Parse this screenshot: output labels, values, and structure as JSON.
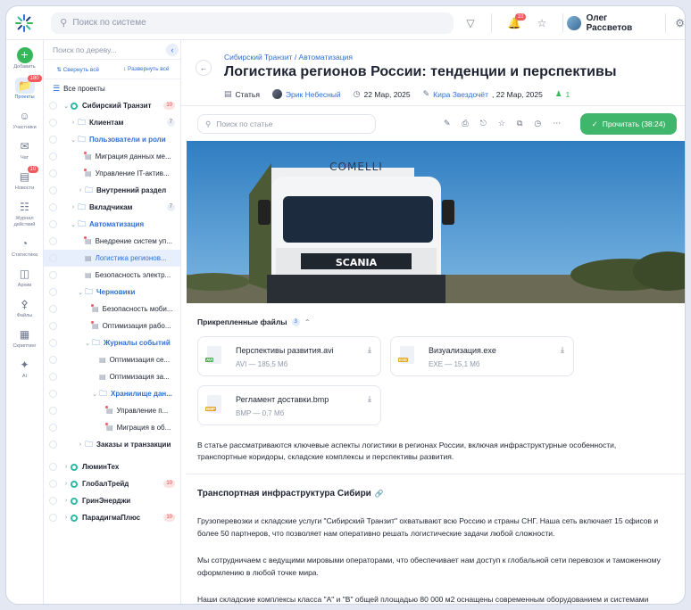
{
  "topbar": {
    "search_placeholder": "Поиск по системе",
    "notifications_badge": "10",
    "user_name": "Олег Рассветов"
  },
  "rail": [
    {
      "label": "Добавить",
      "icon": "plus-icon"
    },
    {
      "label": "Проекты",
      "icon": "folder-icon",
      "badge": "180",
      "active": true
    },
    {
      "label": "Участники",
      "icon": "user-icon"
    },
    {
      "label": "Чат",
      "icon": "chat-icon"
    },
    {
      "label": "Новости",
      "icon": "news-icon",
      "badge": "10"
    },
    {
      "label": "Журнал действий",
      "icon": "journal-icon"
    },
    {
      "label": "Статистика",
      "icon": "pie-chart-icon"
    },
    {
      "label": "Архив",
      "icon": "archive-icon"
    },
    {
      "label": "Файлы",
      "icon": "paperclip-icon"
    },
    {
      "label": "Скриптинг",
      "icon": "script-icon"
    },
    {
      "label": "AI",
      "icon": "ai-icon"
    }
  ],
  "tree": {
    "search_placeholder": "Поиск по дереву...",
    "collapse_all": "Свернуть всё",
    "expand_all": "Развернуть всё",
    "all_projects": "Все проекты",
    "rows": [
      {
        "label": "Сибирский Транзит",
        "type": "project",
        "level": 0,
        "count": "10",
        "countRed": true,
        "expanded": true
      },
      {
        "label": "Клиентам",
        "type": "folder",
        "level": 1,
        "count": "7"
      },
      {
        "label": "Пользователи и роли",
        "type": "folder",
        "level": 1,
        "expanded": true
      },
      {
        "label": "Миграция данных ме...",
        "type": "doc",
        "level": 2,
        "dot": true
      },
      {
        "label": "Управление IT-актив...",
        "type": "doc",
        "level": 2,
        "dot": true
      },
      {
        "label": "Внутренний раздел",
        "type": "folder",
        "level": 2
      },
      {
        "label": "Вкладчикам",
        "type": "folder",
        "level": 1,
        "count": "7"
      },
      {
        "label": "Автоматизация",
        "type": "folder",
        "level": 1,
        "expanded": true
      },
      {
        "label": "Внедрение систем уп...",
        "type": "doc",
        "level": 2,
        "dot": true
      },
      {
        "label": "Логистика регионов...",
        "type": "doc",
        "level": 2,
        "selected": true
      },
      {
        "label": "Безопасность электр...",
        "type": "doc",
        "level": 2
      },
      {
        "label": "Черновики",
        "type": "folder",
        "level": 2,
        "expanded": true
      },
      {
        "label": "Безопасность моби...",
        "type": "doc",
        "level": 3,
        "dot": true
      },
      {
        "label": "Оптимизация рабо...",
        "type": "doc",
        "level": 3,
        "dot": true
      },
      {
        "label": "Журналы событий",
        "type": "folder",
        "level": 3,
        "expanded": true
      },
      {
        "label": "Оптимизация се...",
        "type": "doc",
        "level": 4
      },
      {
        "label": "Оптимизация за...",
        "type": "doc",
        "level": 4
      },
      {
        "label": "Хранилище дан...",
        "type": "folder",
        "level": 4,
        "expanded": true
      },
      {
        "label": "Управление п...",
        "type": "doc",
        "level": 5,
        "dot": true
      },
      {
        "label": "Миграция в об...",
        "type": "doc",
        "level": 5,
        "dot": true
      },
      {
        "label": "Заказы и транзакции",
        "type": "folder",
        "level": 2
      },
      {
        "label": "ЛюминТех",
        "type": "project",
        "level": 0
      },
      {
        "label": "ГлобалТрейд",
        "type": "project",
        "level": 0,
        "count": "10",
        "countRed": true
      },
      {
        "label": "ГринЭнерджи",
        "type": "project",
        "level": 0
      },
      {
        "label": "ПарадигмаПлюс",
        "type": "project",
        "level": 0,
        "count": "10",
        "countRed": true
      }
    ]
  },
  "article": {
    "breadcrumb": "Сибирский Транзит / Автоматизация",
    "title": "Логистика регионов России: тенденции и перспективы",
    "type_label": "Статья",
    "author": "Эрик Небесный",
    "created": "22 Мар, 2025",
    "editor": "Кира Звездочёт",
    "edited": ", 22 Мар, 2025",
    "participants": "1",
    "search_placeholder": "Поиск по статье",
    "read_button": "Прочитать (38:24)",
    "attached_title": "Прикрепленные файлы",
    "attached_count": "3",
    "files": [
      {
        "name": "Перспективы развития.avi",
        "meta": "AVI — 185,5 Мб",
        "tag": "AVI",
        "color": "#4caf50"
      },
      {
        "name": "Визуализация.exe",
        "meta": "EXE — 15,1 Мб",
        "tag": "EXE",
        "color": "#e0a526"
      },
      {
        "name": "Регламент доставки.bmp",
        "meta": "BMP — 0,7 Мб",
        "tag": "BMP",
        "color": "#e0a526"
      }
    ],
    "intro": "В статье рассматриваются ключевые аспекты логистики в регионах России, включая инфраструктурные особенности, транспортные коридоры, складские комплексы и перспективы развития.",
    "section_title": "Транспортная инфраструктура Сибири",
    "paragraphs": [
      "Грузоперевозки и складские услуги \"Сибирский Транзит\" охватывают всю Россию и страны СНГ. Наша сеть включает 15 офисов и более 50 партнеров, что позволяет нам оперативно решать логистические задачи любой сложности.",
      "Мы сотрудничаем с ведущими мировыми операторами, что обеспечивает нам доступ к глобальной сети перевозок и таможенному оформлению в любой точке мира.",
      "Наши складские комплексы класса \"А\" и \"В\" общей площадью 80 000 м2 оснащены современным оборудованием и системами"
    ],
    "hero_texts": {
      "trailer_brand": "COMELLI",
      "truck_brand": "SCANIA"
    }
  }
}
